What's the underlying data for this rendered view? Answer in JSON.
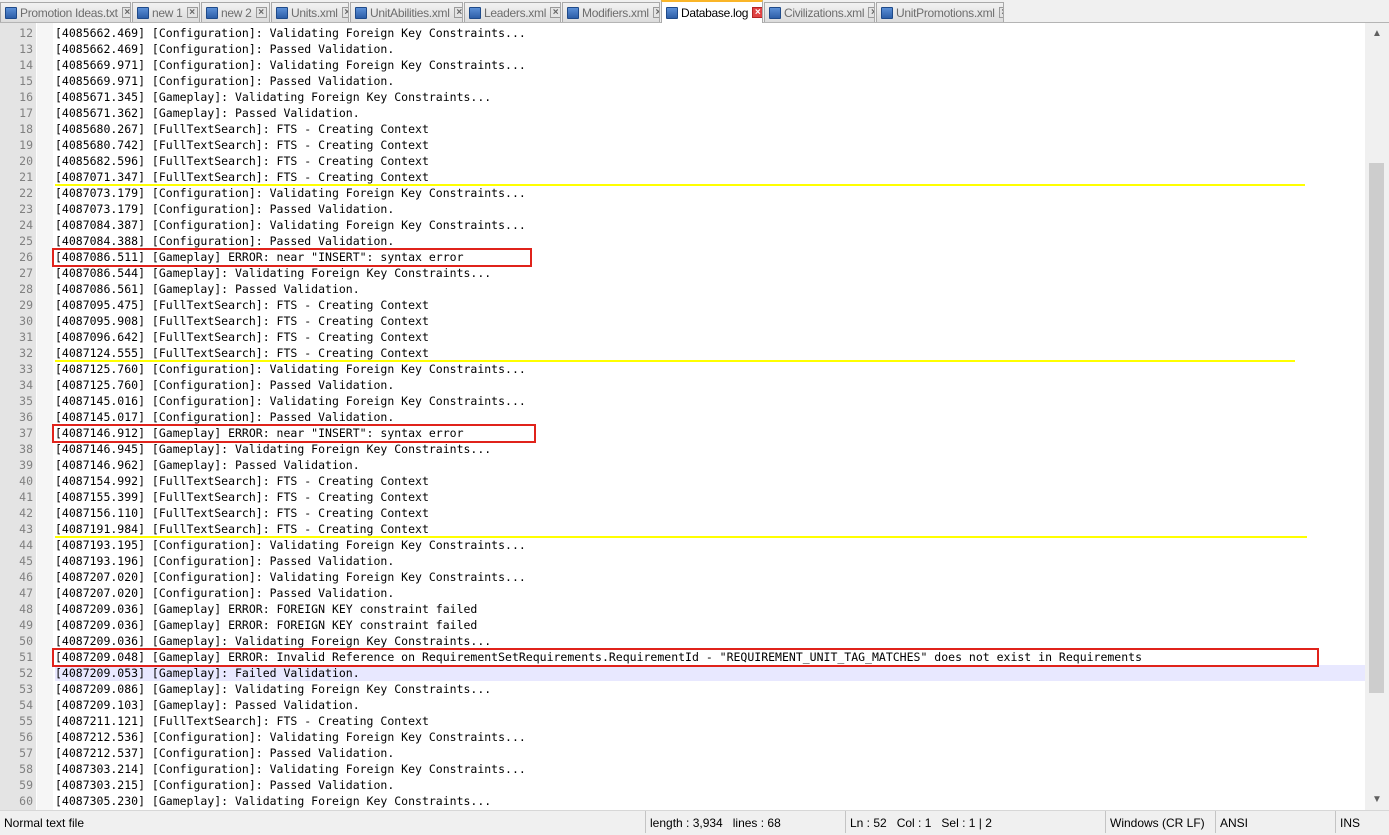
{
  "tabs": [
    {
      "label": "Promotion Ideas.txt",
      "active": false
    },
    {
      "label": "new 1",
      "active": false
    },
    {
      "label": "new 2",
      "active": false
    },
    {
      "label": "Units.xml",
      "active": false
    },
    {
      "label": "UnitAbilities.xml",
      "active": false
    },
    {
      "label": "Leaders.xml",
      "active": false
    },
    {
      "label": "Modifiers.xml",
      "active": false
    },
    {
      "label": "Database.log",
      "active": true
    },
    {
      "label": "Civilizations.xml",
      "active": false
    },
    {
      "label": "UnitPromotions.xml",
      "active": false
    }
  ],
  "editor": {
    "current_line": 52,
    "lines": [
      {
        "num": "12",
        "text": "[4085662.469] [Configuration]: Validating Foreign Key Constraints..."
      },
      {
        "num": "13",
        "text": "[4085662.469] [Configuration]: Passed Validation."
      },
      {
        "num": "14",
        "text": "[4085669.971] [Configuration]: Validating Foreign Key Constraints..."
      },
      {
        "num": "15",
        "text": "[4085669.971] [Configuration]: Passed Validation."
      },
      {
        "num": "16",
        "text": "[4085671.345] [Gameplay]: Validating Foreign Key Constraints..."
      },
      {
        "num": "17",
        "text": "[4085671.362] [Gameplay]: Passed Validation."
      },
      {
        "num": "18",
        "text": "[4085680.267] [FullTextSearch]: FTS - Creating Context"
      },
      {
        "num": "19",
        "text": "[4085680.742] [FullTextSearch]: FTS - Creating Context"
      },
      {
        "num": "20",
        "text": "[4085682.596] [FullTextSearch]: FTS - Creating Context"
      },
      {
        "num": "21",
        "text": "[4087071.347] [FullTextSearch]: FTS - Creating Context"
      },
      {
        "num": "22",
        "text": "[4087073.179] [Configuration]: Validating Foreign Key Constraints..."
      },
      {
        "num": "23",
        "text": "[4087073.179] [Configuration]: Passed Validation."
      },
      {
        "num": "24",
        "text": "[4087084.387] [Configuration]: Validating Foreign Key Constraints..."
      },
      {
        "num": "25",
        "text": "[4087084.388] [Configuration]: Passed Validation."
      },
      {
        "num": "26",
        "text": "[4087086.511] [Gameplay] ERROR: near \"INSERT\": syntax error"
      },
      {
        "num": "27",
        "text": "[4087086.544] [Gameplay]: Validating Foreign Key Constraints..."
      },
      {
        "num": "28",
        "text": "[4087086.561] [Gameplay]: Passed Validation."
      },
      {
        "num": "29",
        "text": "[4087095.475] [FullTextSearch]: FTS - Creating Context"
      },
      {
        "num": "30",
        "text": "[4087095.908] [FullTextSearch]: FTS - Creating Context"
      },
      {
        "num": "31",
        "text": "[4087096.642] [FullTextSearch]: FTS - Creating Context"
      },
      {
        "num": "32",
        "text": "[4087124.555] [FullTextSearch]: FTS - Creating Context"
      },
      {
        "num": "33",
        "text": "[4087125.760] [Configuration]: Validating Foreign Key Constraints..."
      },
      {
        "num": "34",
        "text": "[4087125.760] [Configuration]: Passed Validation."
      },
      {
        "num": "35",
        "text": "[4087145.016] [Configuration]: Validating Foreign Key Constraints..."
      },
      {
        "num": "36",
        "text": "[4087145.017] [Configuration]: Passed Validation."
      },
      {
        "num": "37",
        "text": "[4087146.912] [Gameplay] ERROR: near \"INSERT\": syntax error"
      },
      {
        "num": "38",
        "text": "[4087146.945] [Gameplay]: Validating Foreign Key Constraints..."
      },
      {
        "num": "39",
        "text": "[4087146.962] [Gameplay]: Passed Validation."
      },
      {
        "num": "40",
        "text": "[4087154.992] [FullTextSearch]: FTS - Creating Context"
      },
      {
        "num": "41",
        "text": "[4087155.399] [FullTextSearch]: FTS - Creating Context"
      },
      {
        "num": "42",
        "text": "[4087156.110] [FullTextSearch]: FTS - Creating Context"
      },
      {
        "num": "43",
        "text": "[4087191.984] [FullTextSearch]: FTS - Creating Context"
      },
      {
        "num": "44",
        "text": "[4087193.195] [Configuration]: Validating Foreign Key Constraints..."
      },
      {
        "num": "45",
        "text": "[4087193.196] [Configuration]: Passed Validation."
      },
      {
        "num": "46",
        "text": "[4087207.020] [Configuration]: Validating Foreign Key Constraints..."
      },
      {
        "num": "47",
        "text": "[4087207.020] [Configuration]: Passed Validation."
      },
      {
        "num": "48",
        "text": "[4087209.036] [Gameplay] ERROR: FOREIGN KEY constraint failed"
      },
      {
        "num": "49",
        "text": "[4087209.036] [Gameplay] ERROR: FOREIGN KEY constraint failed"
      },
      {
        "num": "50",
        "text": "[4087209.036] [Gameplay]: Validating Foreign Key Constraints..."
      },
      {
        "num": "51",
        "text": "[4087209.048] [Gameplay] ERROR: Invalid Reference on RequirementSetRequirements.RequirementId - \"REQUIREMENT_UNIT_TAG_MATCHES\" does not exist in Requirements"
      },
      {
        "num": "52",
        "text": "[4087209.053] [Gameplay]: Failed Validation."
      },
      {
        "num": "53",
        "text": "[4087209.086] [Gameplay]: Validating Foreign Key Constraints..."
      },
      {
        "num": "54",
        "text": "[4087209.103] [Gameplay]: Passed Validation."
      },
      {
        "num": "55",
        "text": "[4087211.121] [FullTextSearch]: FTS - Creating Context"
      },
      {
        "num": "56",
        "text": "[4087212.536] [Configuration]: Validating Foreign Key Constraints..."
      },
      {
        "num": "57",
        "text": "[4087212.537] [Configuration]: Passed Validation."
      },
      {
        "num": "58",
        "text": "[4087303.214] [Configuration]: Validating Foreign Key Constraints..."
      },
      {
        "num": "59",
        "text": "[4087303.215] [Configuration]: Passed Validation."
      },
      {
        "num": "60",
        "text": "[4087305.230] [Gameplay]: Validating Foreign Key Constraints..."
      }
    ],
    "annotations": {
      "yellow_lines_after": [
        21,
        32,
        43
      ],
      "red_boxes": [
        26,
        37,
        51
      ],
      "yellow_color": "#ffff00",
      "red_color": "#e0231b"
    }
  },
  "scrollbar": {
    "up_icon": "▲",
    "down_icon": "▼"
  },
  "statusbar": {
    "file_type": "Normal text file",
    "length": "length : 3,934",
    "lines": "lines : 68",
    "ln": "Ln : 52",
    "col": "Col : 1",
    "sel": "Sel : 1 | 2",
    "eol": "Windows (CR LF)",
    "encoding": "ANSI",
    "mode": "INS"
  }
}
